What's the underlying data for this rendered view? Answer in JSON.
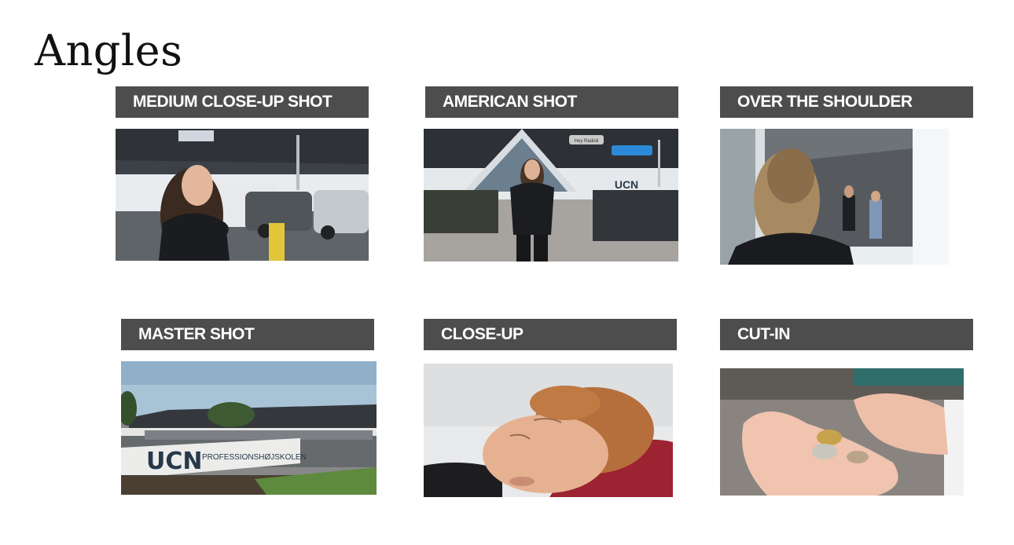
{
  "slide": {
    "title": "Angles"
  },
  "shots": [
    {
      "label": "MEDIUM CLOSE-UP SHOT"
    },
    {
      "label": "AMERICAN SHOT"
    },
    {
      "label": "OVER THE SHOULDER"
    },
    {
      "label": "MASTER SHOT"
    },
    {
      "label": "CLOSE-UP"
    },
    {
      "label": "CUT-IN"
    }
  ],
  "photo_text": {
    "app_notification": "Hey Radioli",
    "ucn_logo": "UCN",
    "sign_school": "PROFESSIONSHØJSKOLEN"
  },
  "colors": {
    "label_bar": "#4d4d4d",
    "label_text": "#ffffff",
    "title_text": "#111111"
  }
}
